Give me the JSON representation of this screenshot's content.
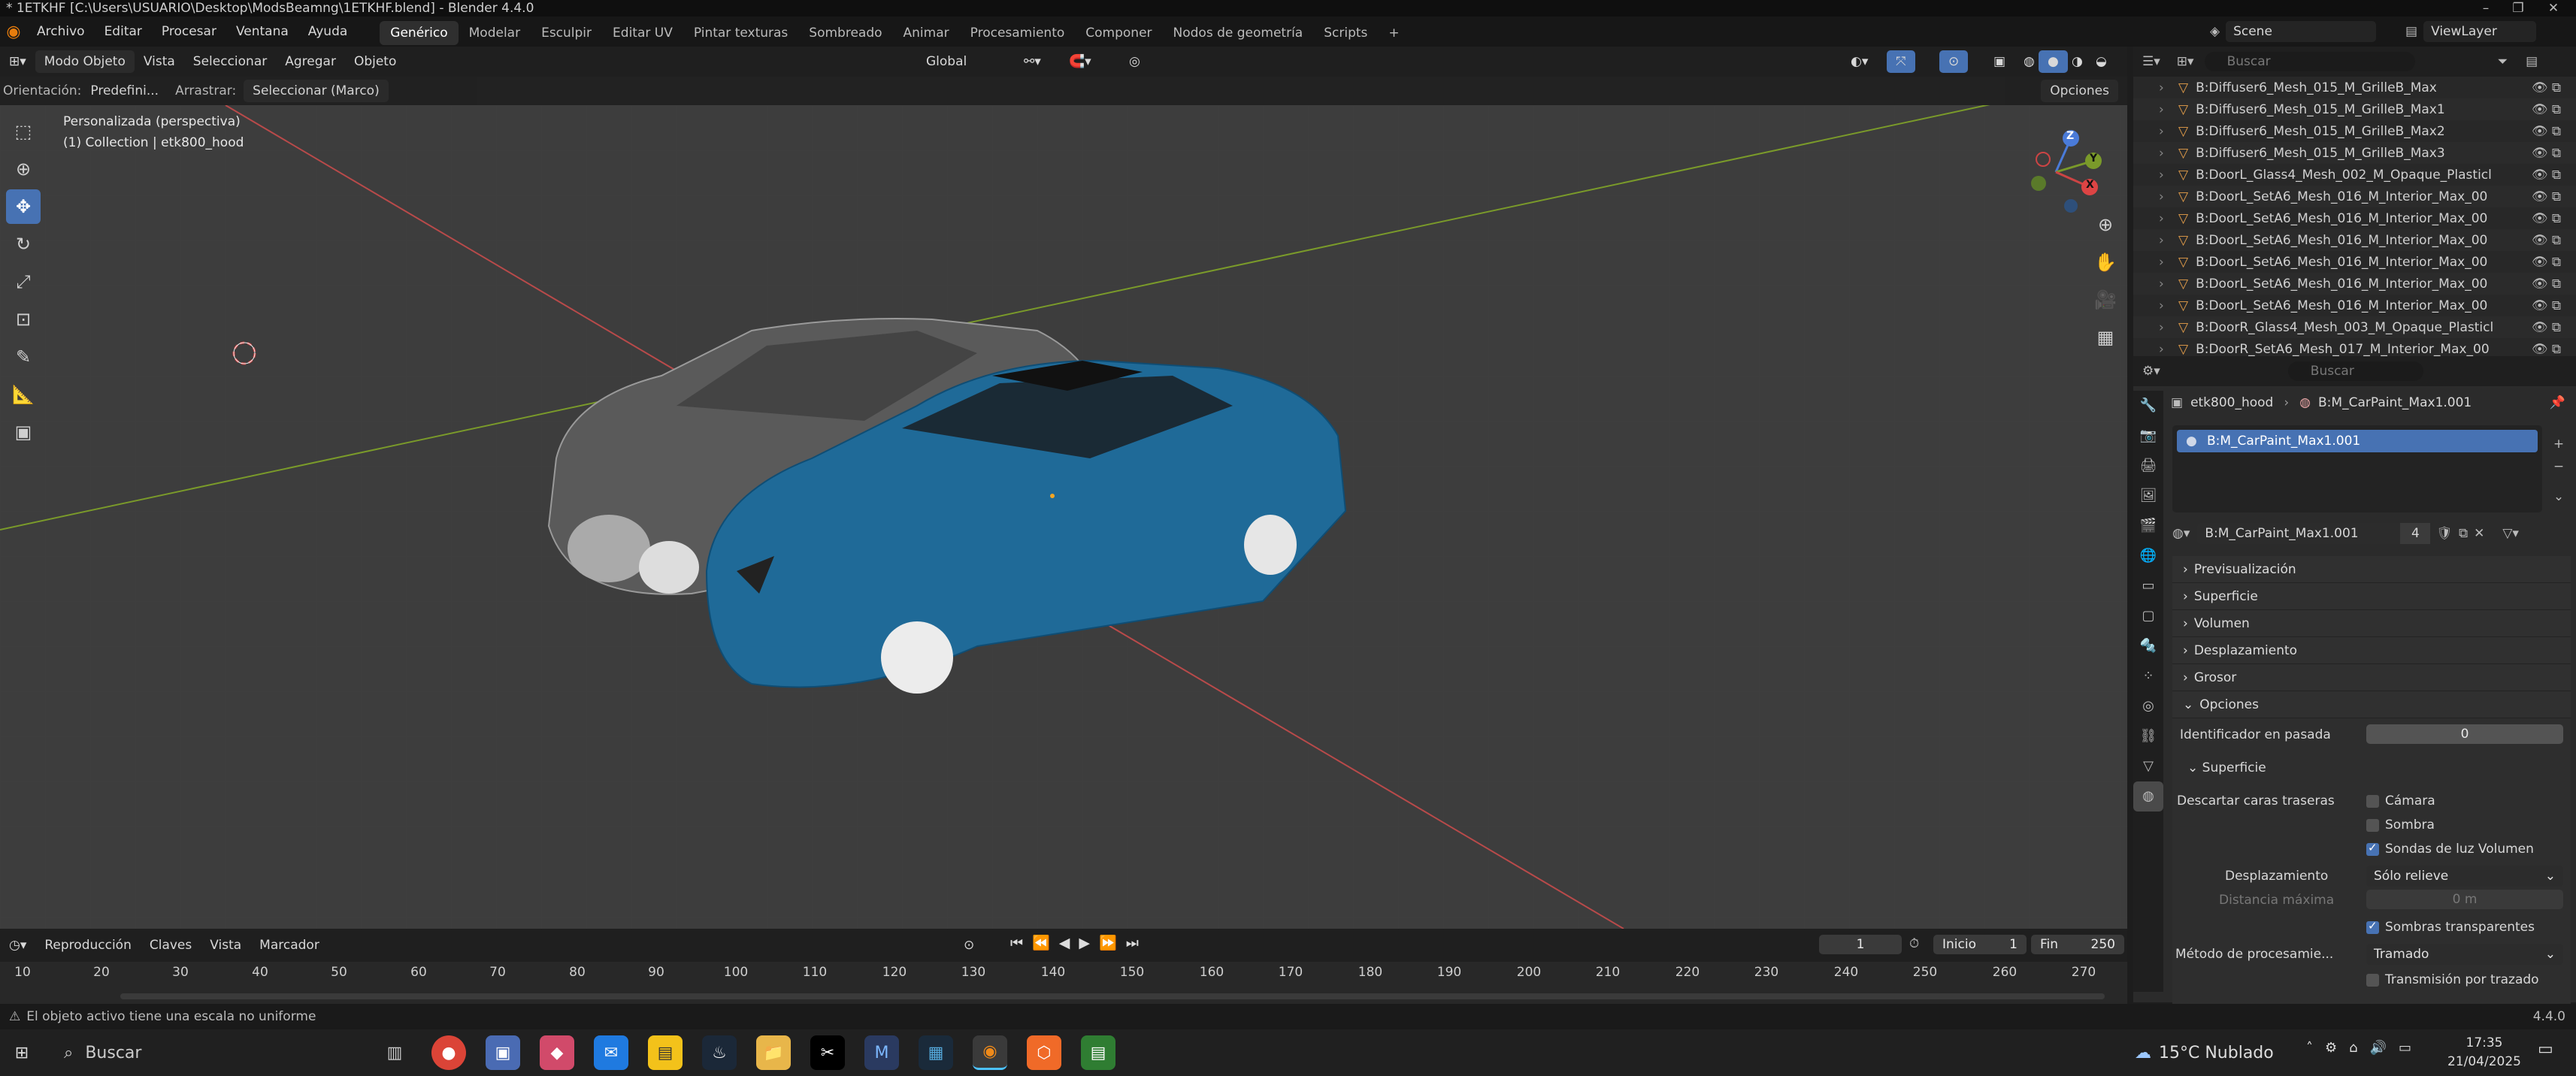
{
  "window": {
    "title": "* 1ETKHF [C:\\Users\\USUARIO\\Desktop\\ModsBeamng\\1ETKHF.blend] - Blender 4.4.0"
  },
  "menu": [
    "Archivo",
    "Editar",
    "Procesar",
    "Ventana",
    "Ayuda"
  ],
  "workspaces": [
    "Genérico",
    "Modelar",
    "Esculpir",
    "Editar UV",
    "Pintar texturas",
    "Sombreado",
    "Animar",
    "Procesamiento",
    "Componer",
    "Nodos de geometría",
    "Scripts"
  ],
  "active_workspace": "Genérico",
  "scene": {
    "scene_name": "Scene",
    "view_layer": "ViewLayer"
  },
  "header3d": {
    "mode": "Modo Objeto",
    "menus": [
      "Vista",
      "Seleccionar",
      "Agregar",
      "Objeto"
    ],
    "transform": "Global"
  },
  "subheader": {
    "orientation_label": "Orientación:",
    "orientation_value": "Predefini...",
    "drag_label": "Arrastrar:",
    "drag_value": "Seleccionar (Marco)",
    "options": "Opciones"
  },
  "viewport": {
    "view_name": "Personalizada (perspectiva)",
    "collection": "(1) Collection | etk800_hood",
    "axis_x": "X",
    "axis_y": "Y",
    "axis_z": "Z",
    "colors": {
      "bg": "#3d3d3d",
      "car_blue": "#1f6a98",
      "x_axis": "#b84a4a",
      "y_axis": "#7a9a2a"
    }
  },
  "outliner": {
    "search_placeholder": "Buscar",
    "items": [
      "B:Diffuser6_Mesh_015_M_GrilleB_Max",
      "B:Diffuser6_Mesh_015_M_GrilleB_Max1",
      "B:Diffuser6_Mesh_015_M_GrilleB_Max2",
      "B:Diffuser6_Mesh_015_M_GrilleB_Max3",
      "B:DoorL_Glass4_Mesh_002_M_Opaque_Plasticl",
      "B:DoorL_SetA6_Mesh_016_M_Interior_Max_00",
      "B:DoorL_SetA6_Mesh_016_M_Interior_Max_00",
      "B:DoorL_SetA6_Mesh_016_M_Interior_Max_00",
      "B:DoorL_SetA6_Mesh_016_M_Interior_Max_00",
      "B:DoorL_SetA6_Mesh_016_M_Interior_Max_00",
      "B:DoorL_SetA6_Mesh_016_M_Interior_Max_00",
      "B:DoorR_Glass4_Mesh_003_M_Opaque_Plasticl",
      "B:DoorR_SetA6_Mesh_017_M_Interior_Max_00"
    ]
  },
  "properties": {
    "search_placeholder": "Buscar",
    "breadcrumb_object": "etk800_hood",
    "breadcrumb_material": "B:M_CarPaint_Max1.001",
    "slot_selected": "B:M_CarPaint_Max1.001",
    "material_name": "B:M_CarPaint_Max1.001",
    "users": "4",
    "panels": [
      "Previsualización",
      "Superficie",
      "Volumen",
      "Desplazamiento",
      "Grosor",
      "Opciones"
    ],
    "options": {
      "pass_index_label": "Identificador en pasada",
      "pass_index_value": "0",
      "surface_sub": "Superficie",
      "backface_label": "Descartar caras traseras",
      "backface_camera": "Cámara",
      "backface_shadow": "Sombra",
      "light_probe": "Sondas de luz Volumen",
      "displacement_label": "Desplazamiento",
      "displacement_value": "Sólo relieve",
      "max_distance_label": "Distancia máxima",
      "max_distance_value": "0 m",
      "transparent_shadows": "Sombras transparentes",
      "render_method_label": "Método de procesamie...",
      "render_method_value": "Tramado",
      "raytrace_transmission": "Transmisión por trazado"
    }
  },
  "timeline": {
    "menus": [
      "Reproducción",
      "Claves",
      "Vista",
      "Marcador"
    ],
    "current_frame": "1",
    "start_label": "Inicio",
    "start_value": "1",
    "end_label": "Fin",
    "end_value": "250",
    "ticks": [
      "10",
      "20",
      "30",
      "40",
      "50",
      "60",
      "70",
      "80",
      "90",
      "100",
      "110",
      "120",
      "130",
      "140",
      "150",
      "160",
      "170",
      "180",
      "190",
      "200",
      "210",
      "220",
      "230",
      "240",
      "250",
      "260",
      "270"
    ]
  },
  "status": {
    "message": "El objeto activo tiene una escala no uniforme",
    "version": "4.4.0"
  },
  "taskbar": {
    "search": "Buscar",
    "weather": "15°C  Nublado",
    "time": "17:35",
    "date": "21/04/2025"
  }
}
